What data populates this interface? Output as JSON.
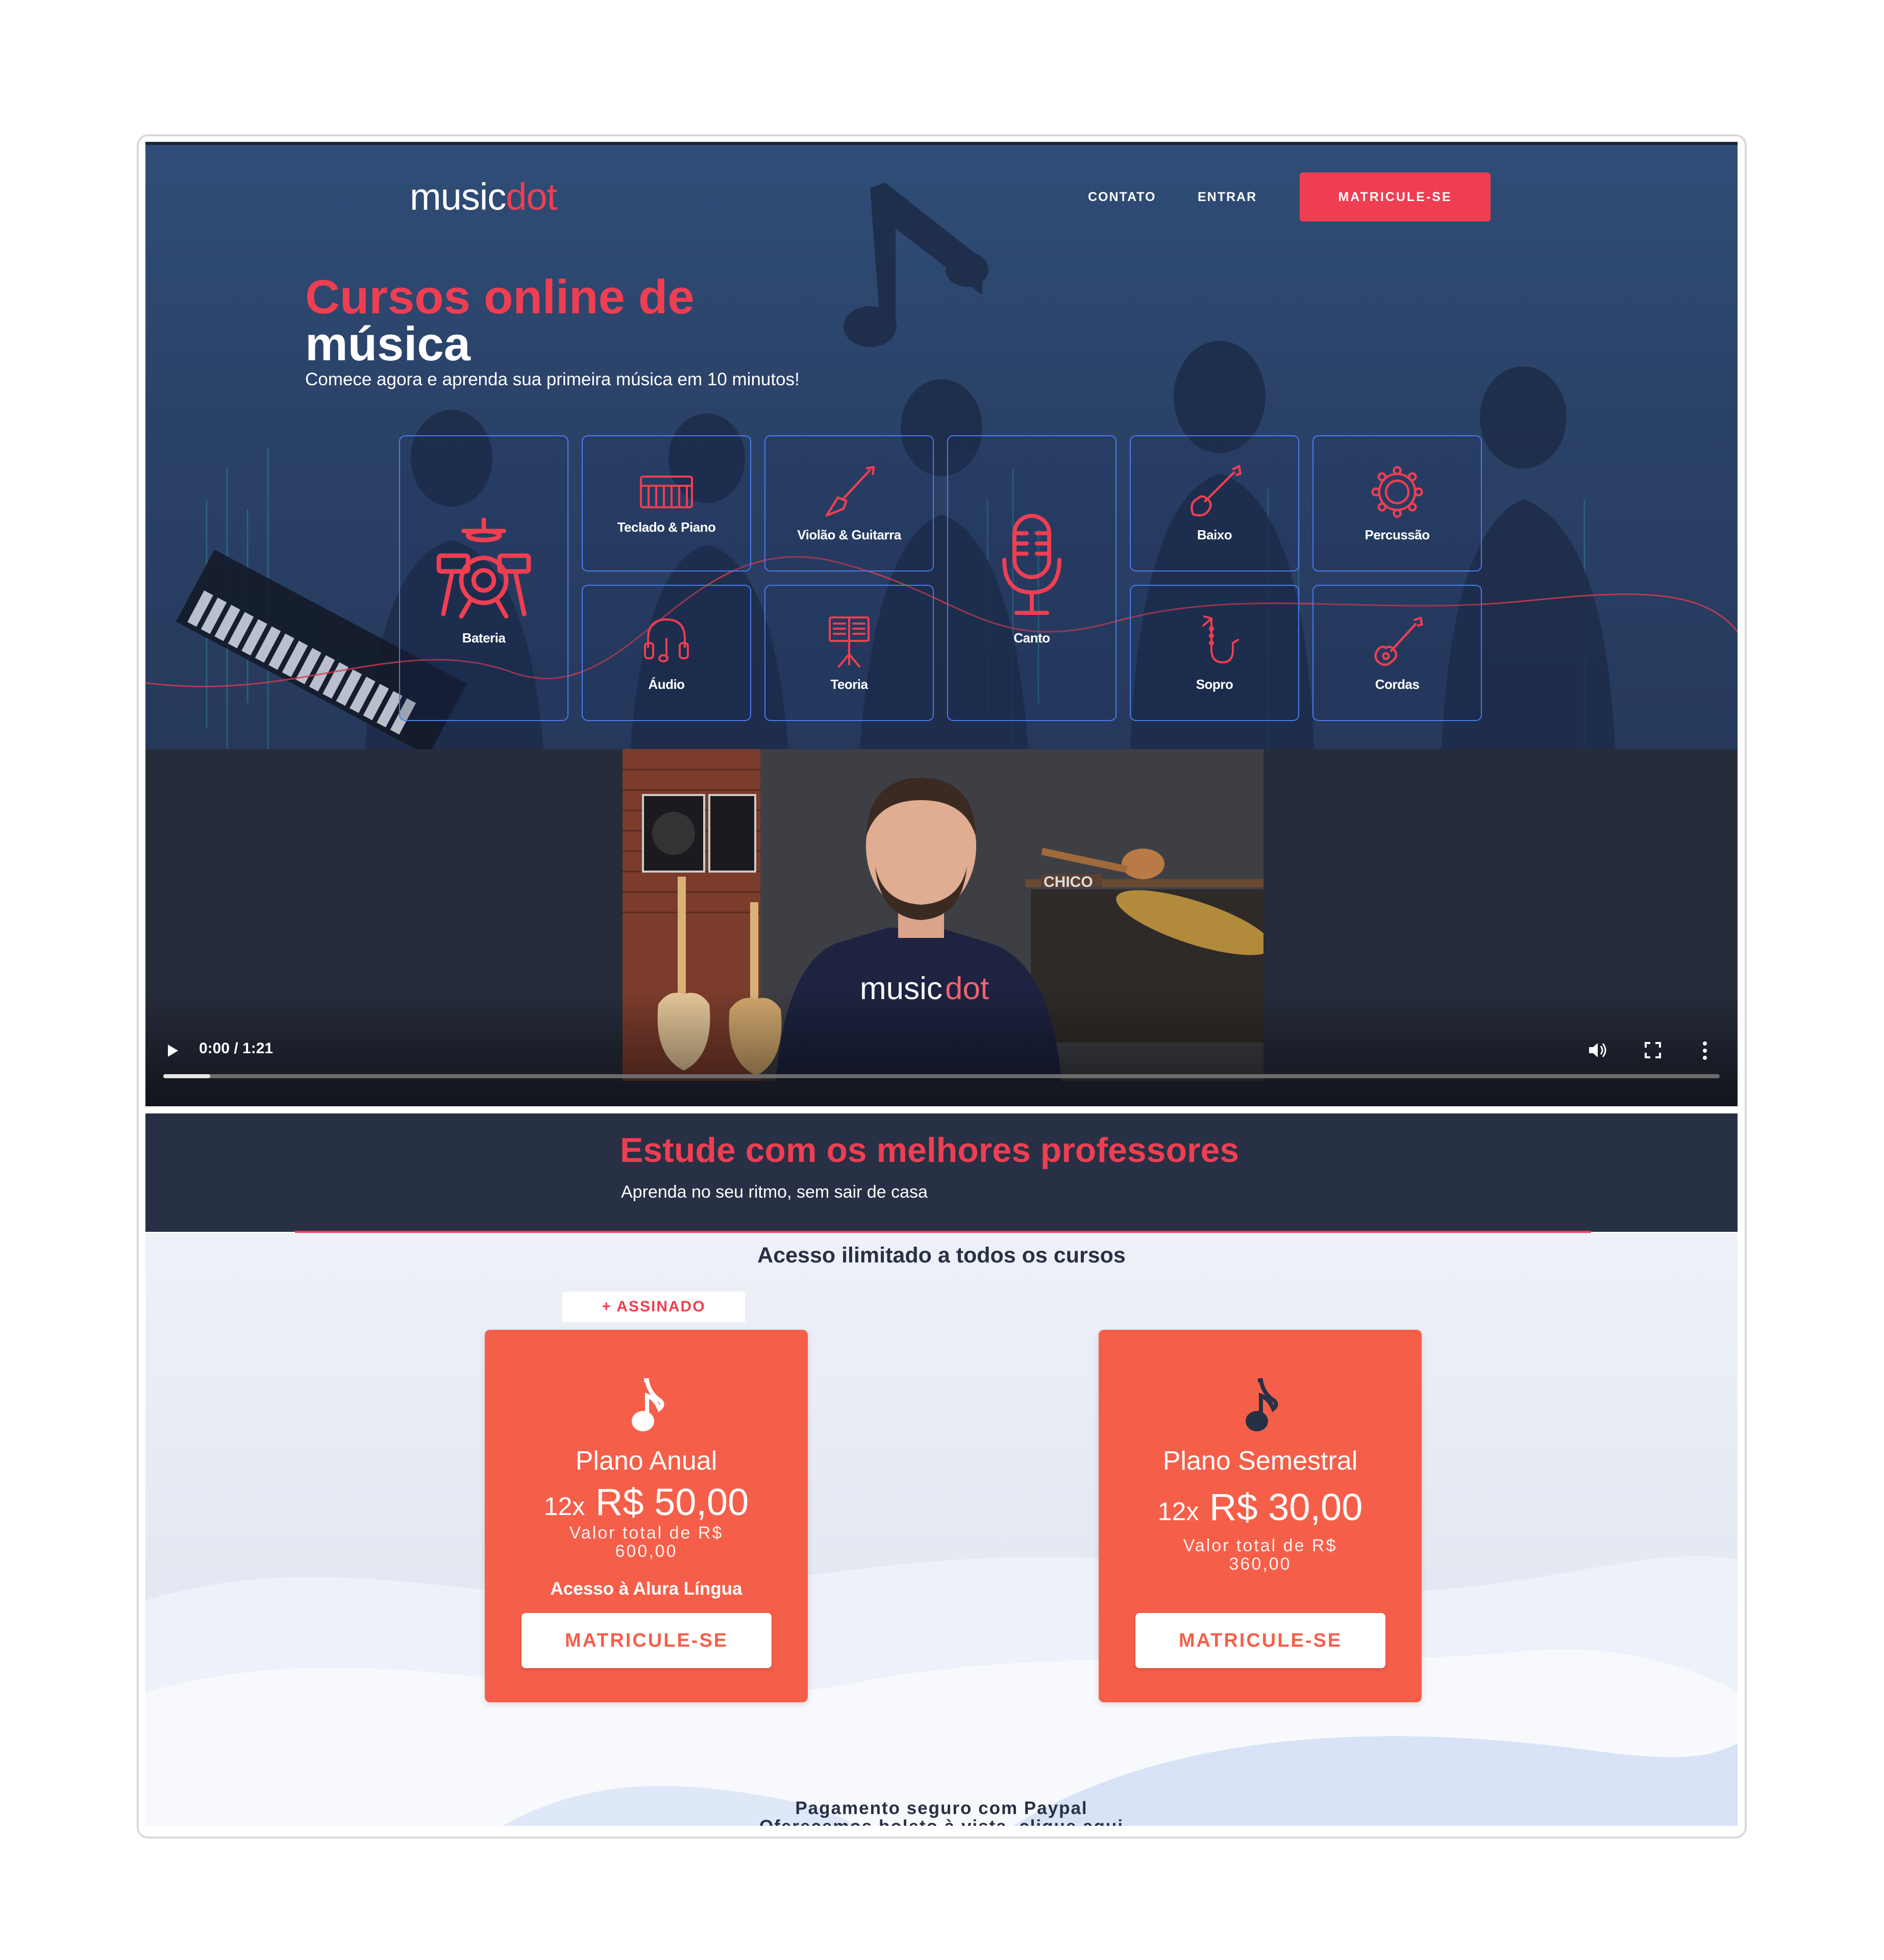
{
  "brand": {
    "logo_part1": "music",
    "logo_part2": "dot",
    "accent": "#ef3e52",
    "navy": "#283045",
    "coral": "#f55f4a"
  },
  "nav": {
    "contact": "CONTATO",
    "login": "ENTRAR",
    "cta": "MATRICULE-SE"
  },
  "hero": {
    "title_line1": "Cursos online de",
    "title_line2": "música",
    "subtitle": "Comece agora e aprenda sua primeira música em 10 minutos!"
  },
  "categories": [
    {
      "label": "Bateria",
      "icon": "drum-kit-icon"
    },
    {
      "label": "Teclado & Piano",
      "icon": "keyboard-icon"
    },
    {
      "label": "Violão & Guitarra",
      "icon": "guitar-icon"
    },
    {
      "label": "Canto",
      "icon": "microphone-icon"
    },
    {
      "label": "Baixo",
      "icon": "bass-icon"
    },
    {
      "label": "Percussão",
      "icon": "tambourine-icon"
    },
    {
      "label": "Áudio",
      "icon": "headphones-icon"
    },
    {
      "label": "Teoria",
      "icon": "music-stand-icon"
    },
    {
      "label": "Sopro",
      "icon": "saxophone-icon"
    },
    {
      "label": "Cordas",
      "icon": "violin-icon"
    }
  ],
  "video": {
    "time": "0:00 / 1:21",
    "progress": 0.03,
    "shirt_text_part1": "music",
    "shirt_text_part2": "dot",
    "sign_text": "CHICO"
  },
  "teachers": {
    "title": "Estude com os melhores professores",
    "subtitle": "Aprenda no seu ritmo, sem sair de casa"
  },
  "pricing": {
    "title": "Acesso ilimitado a todos os cursos",
    "badge": "+ ASSINADO",
    "plans": [
      {
        "name": "Plano Anual",
        "installments": "12x",
        "price": "R$ 50,00",
        "total": "Valor total de R$ 600,00",
        "extra": "Acesso à Alura Língua",
        "button": "MATRICULE-SE"
      },
      {
        "name": "Plano Semestral",
        "installments": "12x",
        "price": "R$ 30,00",
        "total": "Valor total de R$ 360,00",
        "button": "MATRICULE-SE"
      }
    ],
    "footer_line1": "Pagamento seguro com Paypal",
    "footer_line2": "Oferecemos boleto à vista, clique aqui"
  }
}
